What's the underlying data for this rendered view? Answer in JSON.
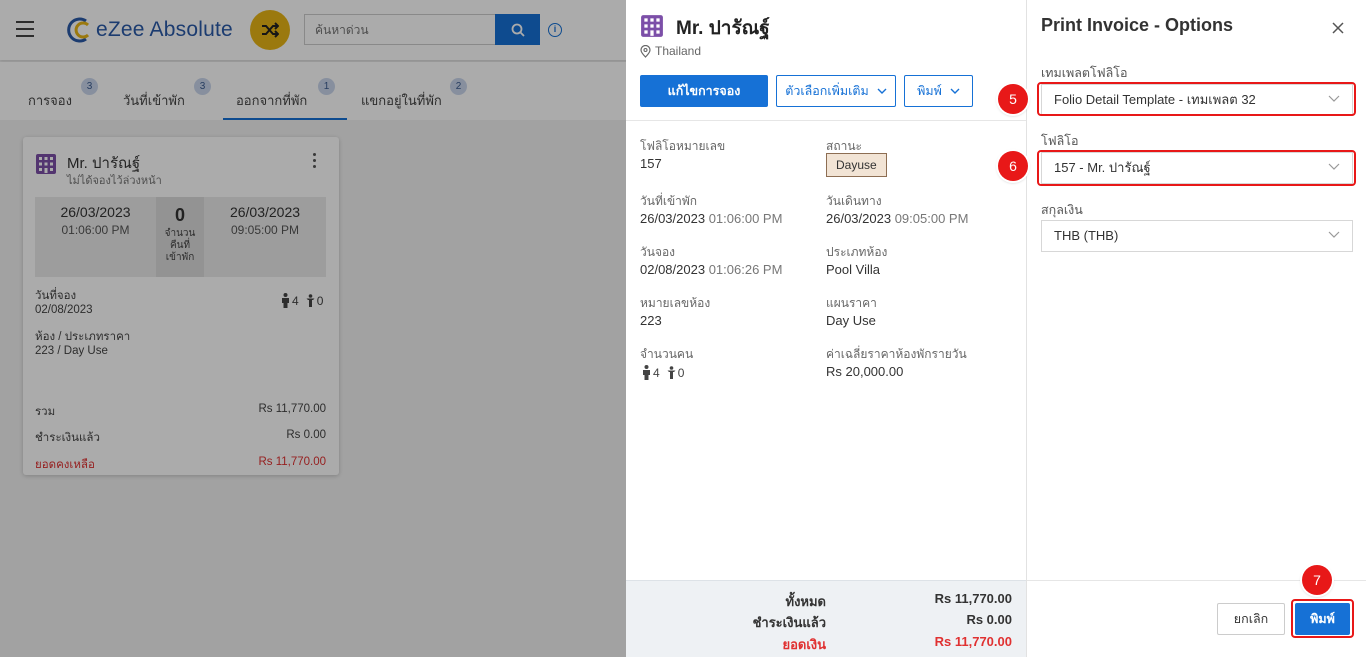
{
  "app": {
    "logo_text": "eZee Absolute"
  },
  "search": {
    "placeholder": "ค้นหาด่วน"
  },
  "tabs": [
    {
      "label": "การจอง",
      "count": "3"
    },
    {
      "label": "วันที่เข้าพัก",
      "count": "3"
    },
    {
      "label": "ออกจากที่พัก",
      "count": "1"
    },
    {
      "label": "แขกอยู่ในที่พัก",
      "count": "2"
    }
  ],
  "card": {
    "guest_name": "Mr. ปารัณฐ์",
    "subtitle": "ไม่ได้จองไว้ล่วงหน้า",
    "arrival_date": "26/03/2023",
    "arrival_time": "01:06:00 PM",
    "nights": "0",
    "nights_label": "จำนวนคืนที่เข้าพัก",
    "departure_date": "26/03/2023",
    "departure_time": "09:05:00 PM",
    "booking_date_label": "วันที่จอง",
    "booking_date": "02/08/2023",
    "adults": "4",
    "children": "0",
    "room_label": "ห้อง / ประเภทราคา",
    "room_value": "223 / Day Use",
    "total_label": "รวม",
    "total_value": "Rs 11,770.00",
    "paid_label": "ชำระเงินแล้ว",
    "paid_value": "Rs 0.00",
    "balance_label": "ยอดคงเหลือ",
    "balance_value": "Rs 11,770.00"
  },
  "folio": {
    "guest_name": "Mr. ปารัณฐ์",
    "location": "Thailand",
    "edit_button": "แก้ไขการจอง",
    "more_button": "ตัวเลือกเพิ่มเติม",
    "print_button": "พิมพ์",
    "fields": {
      "folio_no_label": "โฟลิโอหมายเลข",
      "folio_no": "157",
      "status_label": "สถานะ",
      "status": "Dayuse",
      "checkin_label": "วันที่เข้าพัก",
      "checkin_date": "26/03/2023",
      "checkin_time": "01:06:00 PM",
      "checkout_label": "วันเดินทาง",
      "checkout_date": "26/03/2023",
      "checkout_time": "09:05:00 PM",
      "booking_label": "วันจอง",
      "booking_date": "02/08/2023",
      "booking_time": "01:06:26 PM",
      "room_type_label": "ประเภทห้อง",
      "room_type": "Pool Villa",
      "room_no_label": "หมายเลขห้อง",
      "room_no": "223",
      "rate_plan_label": "แผนราคา",
      "rate_plan": "Day Use",
      "pax_label": "จำนวนคน",
      "adults": "4",
      "children": "0",
      "avg_rate_label": "ค่าเฉลี่ยราคาห้องพักรายวัน",
      "avg_rate": "Rs 20,000.00"
    },
    "totals": {
      "total_label": "ทั้งหมด",
      "total": "Rs 11,770.00",
      "paid_label": "ชำระเงินแล้ว",
      "paid": "Rs 0.00",
      "due_label": "ยอดเงิน",
      "due": "Rs 11,770.00"
    }
  },
  "print_options": {
    "title": "Print Invoice - Options",
    "template_label": "เทมเพลตโฟลิโอ",
    "template_value": "Folio Detail Template - เทมเพลต 32",
    "folio_label": "โฟลิโอ",
    "folio_value": "157 - Mr. ปารัณฐ์",
    "currency_label": "สกุลเงิน",
    "currency_value": "THB (THB)",
    "cancel_button": "ยกเลิก",
    "print_button": "พิมพ์",
    "steps": [
      "5",
      "6",
      "7"
    ]
  },
  "colors": {
    "primary": "#1671d6",
    "highlight": "#e81818",
    "due": "#e03131",
    "accent_yellow": "#e8b516"
  }
}
